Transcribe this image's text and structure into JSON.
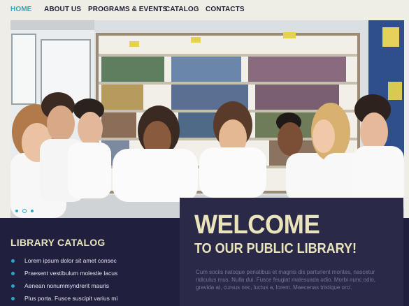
{
  "nav": {
    "items": [
      {
        "label": "HOME",
        "active": true
      },
      {
        "label": "ABOUT US",
        "active": false
      },
      {
        "label": "PROGRAMS & EVENTS",
        "active": false
      },
      {
        "label": "CATALOG",
        "active": false
      },
      {
        "label": "CONTACTS",
        "active": false
      }
    ]
  },
  "hero": {
    "slides_total": 3,
    "active_slide": 1,
    "image": "students-reading-in-library-photo"
  },
  "catalog": {
    "title": "LIBRARY CATALOG",
    "items": [
      "Lorem ipsum dolor sit amet consec",
      "Praesent vestibulum molestie lacus",
      "Aenean nonummyndrerit mauris",
      "Plus porta. Fusce suscipit varius mi"
    ]
  },
  "welcome": {
    "title": "WELCOME",
    "subtitle": "TO OUR PUBLIC LIBRARY!",
    "text": "Cum sociis natoque penatibus et magnis dis parturient montes, nascetur ridiculus mus. Nulla dui. Fusce feugiat malesuada odio. Morbi nunc odio, gravida at, cursus nec, luctus a, lorem. Maecenas tristique orci."
  },
  "colors": {
    "accent": "#2aa6c4",
    "dark_band": "#201f3d",
    "panel": "#2a2948",
    "headline": "#e9e4bb",
    "background": "#efeee6"
  }
}
